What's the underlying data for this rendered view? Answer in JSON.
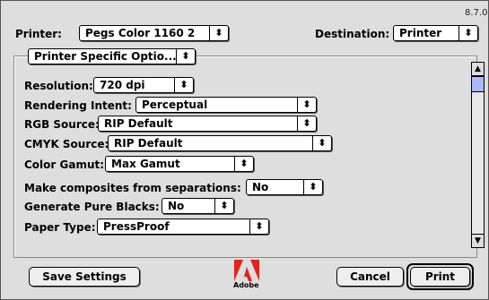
{
  "dialog": {
    "version": "8.7.0",
    "printer_label": "Printer:",
    "printer_value": "Pegs Color 1160 2",
    "destination_label": "Destination:",
    "destination_value": "Printer",
    "panel_menu_value": "Printer Specific Optio...",
    "options": [
      {
        "label": "Resolution:",
        "value": "720 dpi"
      },
      {
        "label": "Rendering Intent:",
        "value": "Perceptual"
      },
      {
        "label": "RGB Source:",
        "value": "RIP Default"
      },
      {
        "label": "CMYK Source:",
        "value": "RIP Default"
      },
      {
        "label": "Color Gamut:",
        "value": "Max Gamut"
      },
      {
        "label": "Make composites from separations:",
        "value": "No"
      },
      {
        "label": "Generate Pure Blacks:",
        "value": "No"
      },
      {
        "label": "Paper Type:",
        "value": "PressProof"
      }
    ],
    "save_settings": "Save Settings",
    "cancel": "Cancel",
    "print": "Print",
    "logo_text": "Adobe",
    "arrows_glyph": "⬍"
  }
}
